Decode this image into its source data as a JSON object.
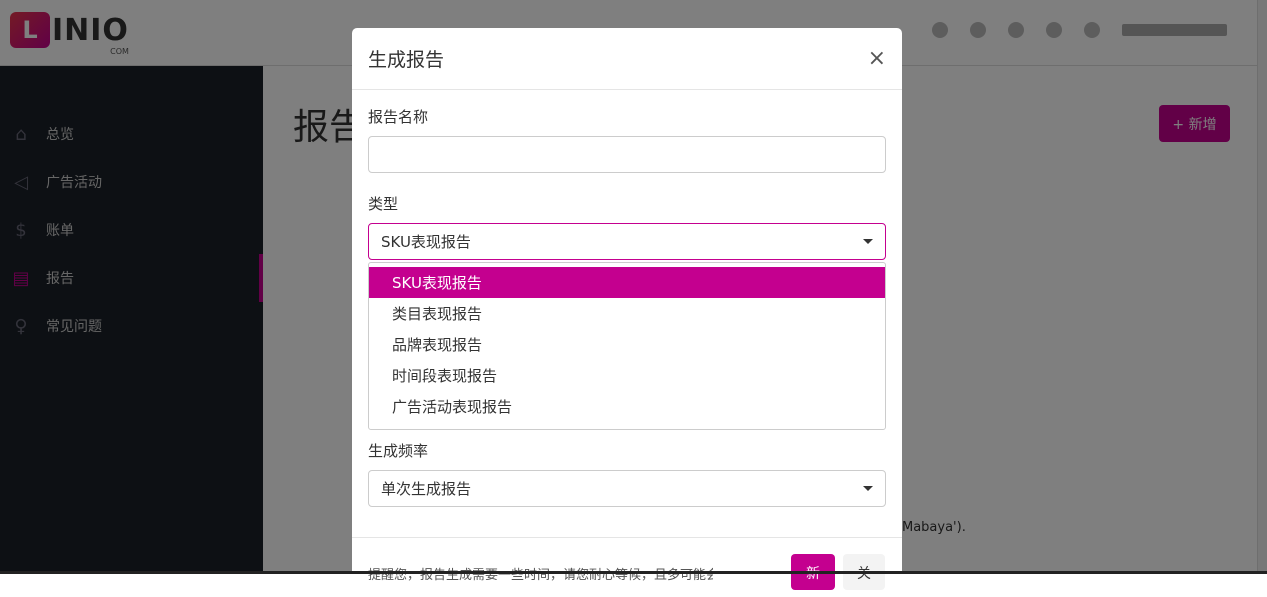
{
  "app": {
    "logo_text": "INIO",
    "logo_mark": "L",
    "logo_sub": "COM"
  },
  "sidebar": {
    "items": [
      {
        "label": "总览",
        "icon": "home-icon"
      },
      {
        "label": "广告活动",
        "icon": "megaphone-icon"
      },
      {
        "label": "账单",
        "icon": "dollar-icon"
      },
      {
        "label": "报告",
        "icon": "report-icon"
      },
      {
        "label": "常见问题",
        "icon": "lightbulb-icon"
      }
    ],
    "active": 3
  },
  "page": {
    "title": "报告",
    "new_button": "+ 新增",
    "note": "Mabaya')."
  },
  "modal": {
    "title": "生成报告",
    "close": "×",
    "name_label": "报告名称",
    "name_value": "",
    "type_label": "类型",
    "type_value": "SKU表现报告",
    "type_options": [
      "SKU表现报告",
      "类目表现报告",
      "品牌表现报告",
      "时间段表现报告",
      "广告活动表现报告"
    ],
    "freq_label": "生成频率",
    "freq_value": "单次生成报告",
    "footer_note": "提醒您，报告生成需要一些时间，请您耐心等候，且多可能会需",
    "primary_button": "新",
    "secondary_button": "关"
  },
  "colors": {
    "accent": "#c4008f",
    "sidebar": "#1b2128"
  }
}
